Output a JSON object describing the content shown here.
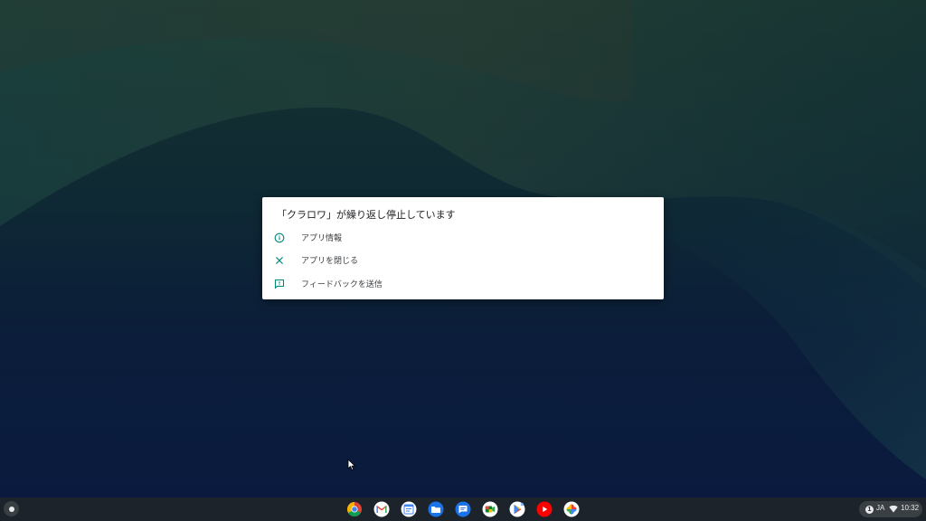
{
  "dialog": {
    "title": "「クラロワ」が繰り返し停止しています",
    "options": [
      {
        "label": "アプリ情報",
        "icon": "info-icon"
      },
      {
        "label": "アプリを閉じる",
        "icon": "close-icon"
      },
      {
        "label": "フィードバックを送信",
        "icon": "feedback-icon"
      }
    ],
    "accent_color": "#00897b"
  },
  "shelf": {
    "apps": [
      "chrome-icon",
      "gmail-icon",
      "calendar-icon",
      "files-icon",
      "messages-icon",
      "meet-icon",
      "play-store-icon",
      "youtube-icon",
      "photos-icon"
    ],
    "status": {
      "notification_count": "1",
      "ime": "JA",
      "time": "10:32"
    }
  }
}
